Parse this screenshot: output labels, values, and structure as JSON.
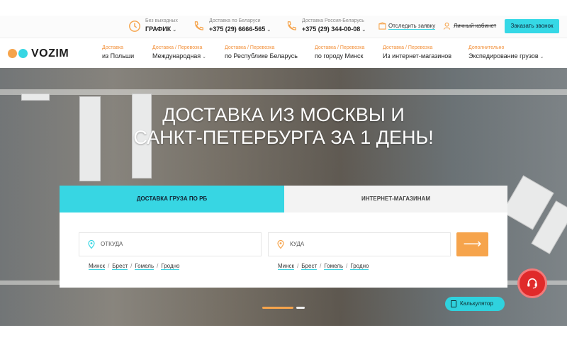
{
  "topbar": {
    "schedule_small": "Без выходных",
    "schedule_big": "ГРАФИК",
    "phone1_small": "Доставка по Беларуси",
    "phone1_big": "+375 (29) 6666-565",
    "phone2_small": "Доставка Россия-Беларусь",
    "phone2_big": "+375 (29) 344-00-08",
    "track_label": "Отследить заявку",
    "cabinet_label": "Личный кабинет",
    "callback_label": "Заказать звонок"
  },
  "logo": {
    "text": "VOZIM",
    "dot1_color": "#f6a44c",
    "dot2_color": "#37d6e3"
  },
  "nav": {
    "items": [
      {
        "small": "Доставка",
        "big": "из Польши"
      },
      {
        "small": "Доставка / Перевозка",
        "big": "Международная"
      },
      {
        "small": "Доставка / Перевозка",
        "big": "по Республике Беларусь"
      },
      {
        "small": "Доставка / Перевозка",
        "big": "по городу Минск"
      },
      {
        "small": "Доставка / Перевозка",
        "big": "Из интернет-магазинов"
      },
      {
        "small": "Дополнительно",
        "big": "Экспедирование грузов"
      }
    ]
  },
  "hero": {
    "title": "ДОСТАВКА ИЗ МОСКВЫ И САНКТ-ПЕТЕРБУРГА ЗА 1 ДЕНЬ!"
  },
  "tabs": {
    "active": "ДОСТАВКА ГРУЗА ПО РБ",
    "inactive": "ИНТЕРНЕТ-МАГАЗИНАМ"
  },
  "form": {
    "from_placeholder": "ОТКУДА",
    "to_placeholder": "КУДА",
    "cities": [
      "Минск",
      "Брест",
      "Гомель",
      "Гродно"
    ],
    "go_symbol": "⟶"
  },
  "widgets": {
    "calc_label": "Калькулятор"
  },
  "colors": {
    "accent": "#37d6e3",
    "orange": "#f6a44c",
    "support_red": "#e02a2a"
  }
}
